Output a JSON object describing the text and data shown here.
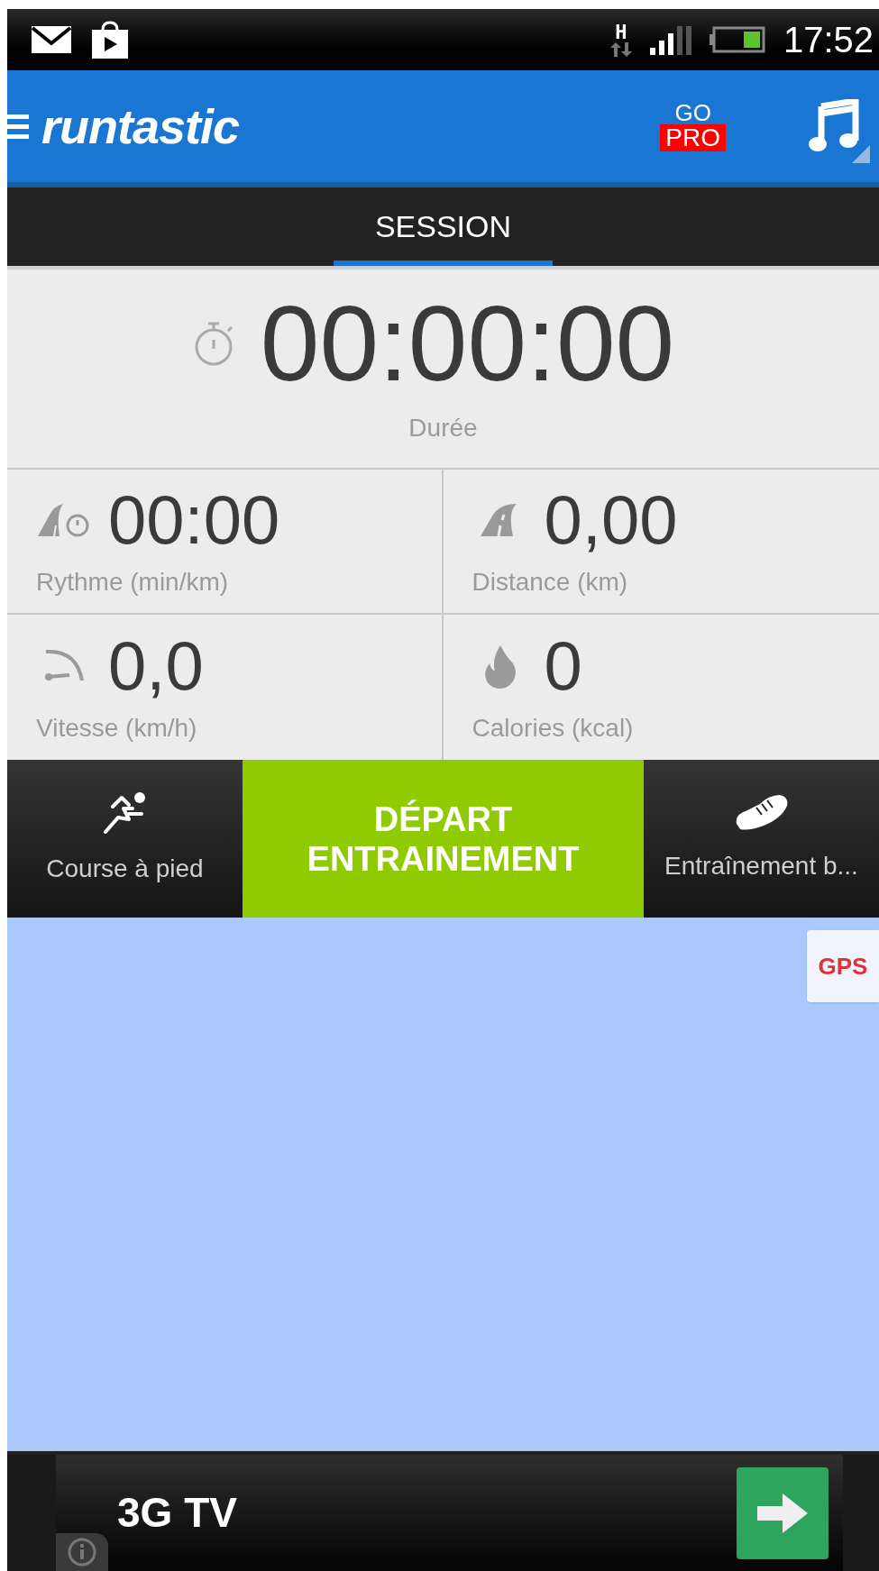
{
  "status_bar": {
    "network": "H",
    "time": "17:52"
  },
  "app_bar": {
    "logo": "runtastic",
    "go": "GO",
    "pro": "PRO"
  },
  "tabs": [
    {
      "label": "SESSION",
      "selected": true
    }
  ],
  "duration": {
    "value": "00:00:00",
    "label": "Durée"
  },
  "stats": [
    {
      "value": "00:00",
      "label": "Rythme (min/km)"
    },
    {
      "value": "0,00",
      "label": "Distance (km)"
    },
    {
      "value": "0,0",
      "label": "Vitesse (km/h)"
    },
    {
      "value": "0",
      "label": "Calories (kcal)"
    }
  ],
  "actions": [
    {
      "kind": "sport",
      "label": "Course à pied"
    },
    {
      "kind": "start",
      "label": "DÉPART ENTRAINEMENT"
    },
    {
      "kind": "workout",
      "label": "Entraînement b..."
    }
  ],
  "map": {
    "gps": "GPS"
  },
  "ad": {
    "title": "3G TV"
  }
}
